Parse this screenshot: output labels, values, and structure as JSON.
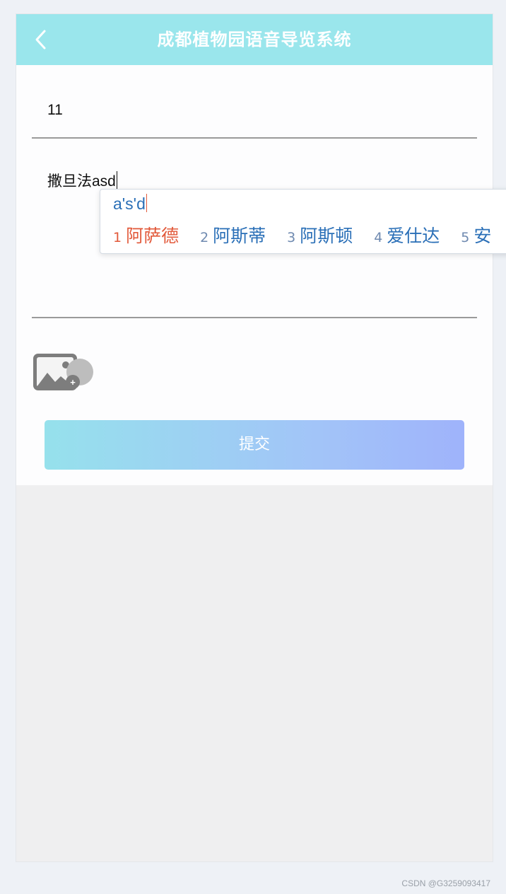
{
  "header": {
    "title": "成都植物园语音导览系统",
    "back_icon": "chevron-left-icon"
  },
  "form": {
    "title_field": {
      "value": "11"
    },
    "content_field": {
      "value": "撒旦法asd"
    },
    "upload": {
      "icon": "image-upload-icon"
    },
    "submit_label": "提交"
  },
  "ime": {
    "composition": "a's'd",
    "candidates": [
      {
        "num": "1",
        "text": "阿萨德"
      },
      {
        "num": "2",
        "text": "阿斯蒂"
      },
      {
        "num": "3",
        "text": "阿斯顿"
      },
      {
        "num": "4",
        "text": "爱仕达"
      },
      {
        "num": "5",
        "text": "安"
      }
    ]
  },
  "watermark": "CSDN @G3259093417",
  "colors": {
    "header_bg": "#9ae6ec",
    "ime_active": "#e2593a",
    "ime_text": "#2a6fb7"
  }
}
